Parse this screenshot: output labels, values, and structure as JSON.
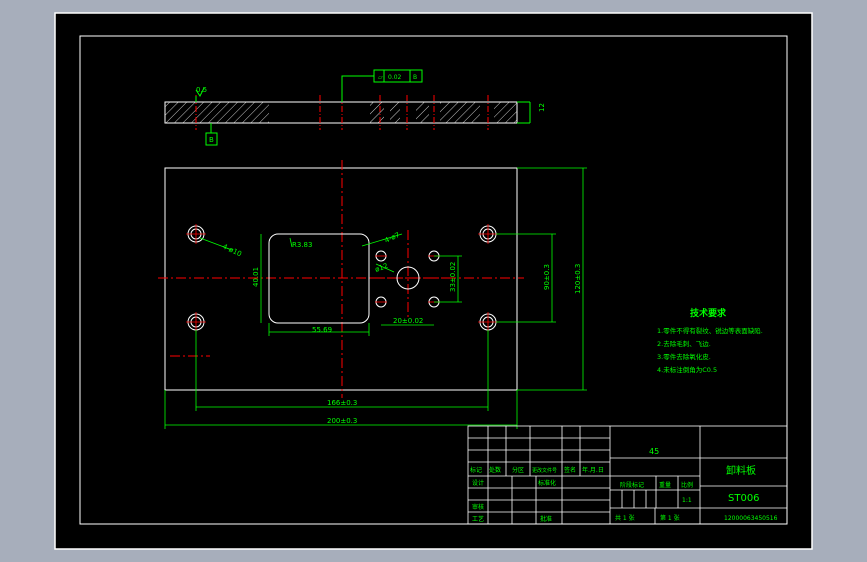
{
  "colors": {
    "background": "#a7aebb",
    "sheet": "#000000",
    "frame": "#ffffff",
    "dimension": "#00ff00",
    "centerline": "#ff0000",
    "outline": "#ffffff",
    "hatch": "#ffffff"
  },
  "dims": {
    "gap": "0.5",
    "tol": "0.02",
    "datum_a": "B",
    "datum_b": "B",
    "thickness": "12",
    "w_inner": "55.69",
    "h_inner": "40.01",
    "corner_r": "R3.83",
    "hole_dia": "ø12",
    "small_hole": "4-ø7",
    "tap_holes": "4-ø10",
    "horiz_pitch": "20±0.02",
    "vert_pitch": "33±0.02",
    "holes_x": "166±0.3",
    "total_w": "200±0.3",
    "holes_y": "90±0.3",
    "total_h": "120±0.3"
  },
  "requirements": {
    "title": "技术要求",
    "items": [
      "1.零件不得有裂纹、锐边等表面缺陷.",
      "2.去除毛刺、飞边.",
      "3.零件去除氧化皮.",
      "4.未标注倒角为C0.5"
    ]
  },
  "titleblock": {
    "material": "45",
    "part_name": "卸料板",
    "drawing_no": "ST006",
    "scale": "1:1",
    "file_no": "12000063450516",
    "headers": [
      "标记",
      "处数",
      "分区",
      "更改文件号",
      "签名",
      "年.月.日"
    ],
    "design": "设计",
    "standardize": "标准化",
    "audit": "审核",
    "process": "工艺",
    "approve": "批准",
    "stage_mark": "阶段标记",
    "weight": "重量",
    "ratio": "比例",
    "sheets_total": "共 1 张",
    "sheet_no": "第 1 张"
  }
}
